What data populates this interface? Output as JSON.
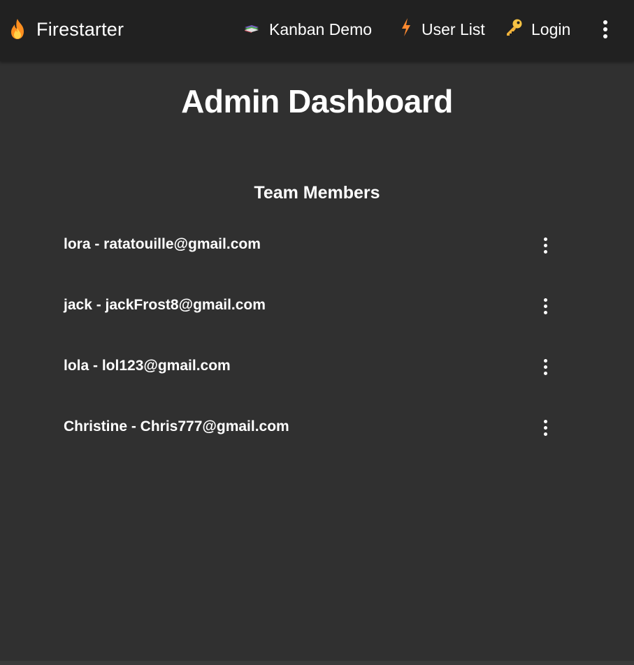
{
  "toolbar": {
    "brand_label": "Firestarter",
    "nav": [
      {
        "label": "Kanban Demo",
        "icon": "books-icon"
      },
      {
        "label": "User List",
        "icon": "lightning-icon"
      },
      {
        "label": "Login",
        "icon": "key-icon"
      }
    ],
    "menu_icon": "more-vert-icon"
  },
  "main": {
    "title": "Admin Dashboard",
    "section_title": "Team Members",
    "members": [
      {
        "text": "lora - ratatouille@gmail.com"
      },
      {
        "text": "jack - jackFrost8@gmail.com"
      },
      {
        "text": "lola - lol123@gmail.com"
      },
      {
        "text": "Christine - Chris777@gmail.com"
      }
    ]
  },
  "colors": {
    "toolbar_bg": "#212121",
    "page_bg": "#303030",
    "text": "#ffffff",
    "flame": "#ff9800",
    "lightning": "#ff8a30",
    "key": "#f6c344"
  }
}
